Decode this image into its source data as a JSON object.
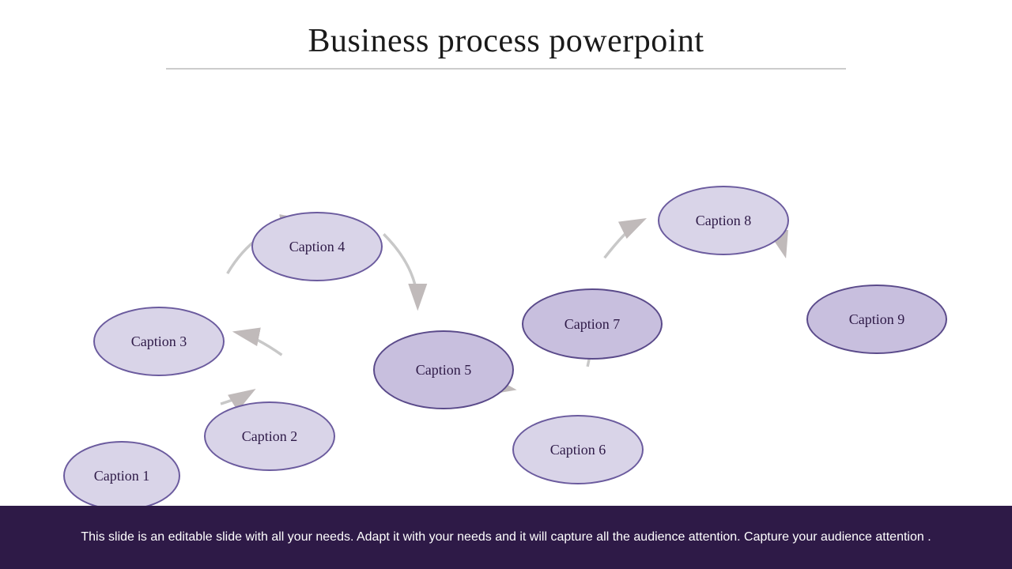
{
  "title": "Business process powerpoint",
  "captions": {
    "c1": "Caption 1",
    "c2": "Caption 2",
    "c3": "Caption 3",
    "c4": "Caption 4",
    "c5": "Caption 5",
    "c6": "Caption 6",
    "c7": "Caption 7",
    "c8": "Caption 8",
    "c9": "Caption 9"
  },
  "footer": "This slide is an editable slide with all your needs. Adapt it with your needs and it will capture all the audience attention. Capture your audience attention .",
  "colors": {
    "title": "#1a1a1a",
    "ellipse_fill_light": "#d9d4e8",
    "ellipse_fill_medium": "#c8bfde",
    "ellipse_border": "#6b5b9e",
    "arrow": "#c8c8c8",
    "footer_bg": "#2e1a47",
    "footer_text": "#ffffff"
  }
}
